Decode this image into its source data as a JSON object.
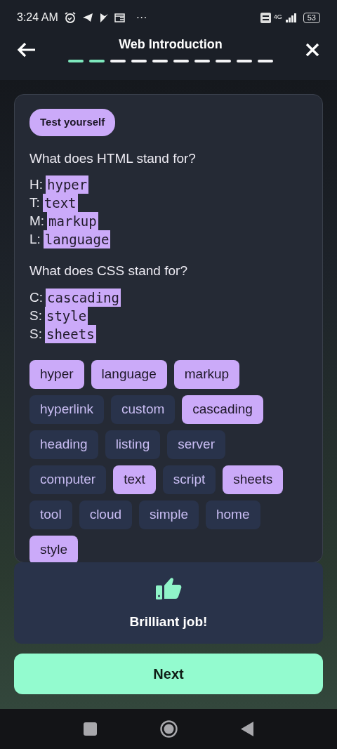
{
  "status_bar": {
    "time": "3:24 AM",
    "more": "···",
    "network": "4G",
    "battery": "53"
  },
  "header": {
    "title": "Web Introduction",
    "progress": [
      {
        "done": true
      },
      {
        "done": true
      },
      {
        "done": false
      },
      {
        "done": false
      },
      {
        "done": false
      },
      {
        "done": false
      },
      {
        "done": false
      },
      {
        "done": false
      },
      {
        "done": false
      },
      {
        "done": false
      }
    ]
  },
  "card": {
    "badge": "Test yourself",
    "questions": [
      {
        "prompt": "What does HTML stand for?",
        "lines": [
          {
            "letter": "H:",
            "answer": "hyper"
          },
          {
            "letter": "T:",
            "answer": "text"
          },
          {
            "letter": "M:",
            "answer": "markup"
          },
          {
            "letter": "L:",
            "answer": "language"
          }
        ]
      },
      {
        "prompt": "What does CSS stand for?",
        "lines": [
          {
            "letter": "C:",
            "answer": "cascading"
          },
          {
            "letter": "S:",
            "answer": "style"
          },
          {
            "letter": "S:",
            "answer": "sheets"
          }
        ]
      }
    ],
    "chips": [
      {
        "label": "hyper",
        "selected": true
      },
      {
        "label": "language",
        "selected": true
      },
      {
        "label": "markup",
        "selected": true
      },
      {
        "label": "hyperlink",
        "selected": false
      },
      {
        "label": "custom",
        "selected": false
      },
      {
        "label": "cascading",
        "selected": true
      },
      {
        "label": "heading",
        "selected": false
      },
      {
        "label": "listing",
        "selected": false
      },
      {
        "label": "server",
        "selected": false
      },
      {
        "label": "computer",
        "selected": false
      },
      {
        "label": "text",
        "selected": true
      },
      {
        "label": "script",
        "selected": false
      },
      {
        "label": "sheets",
        "selected": true
      },
      {
        "label": "tool",
        "selected": false
      },
      {
        "label": "cloud",
        "selected": false
      },
      {
        "label": "simple",
        "selected": false
      },
      {
        "label": "home",
        "selected": false
      },
      {
        "label": "style",
        "selected": true
      }
    ]
  },
  "feedback": {
    "message": "Brilliant job!"
  },
  "next_button": "Next"
}
